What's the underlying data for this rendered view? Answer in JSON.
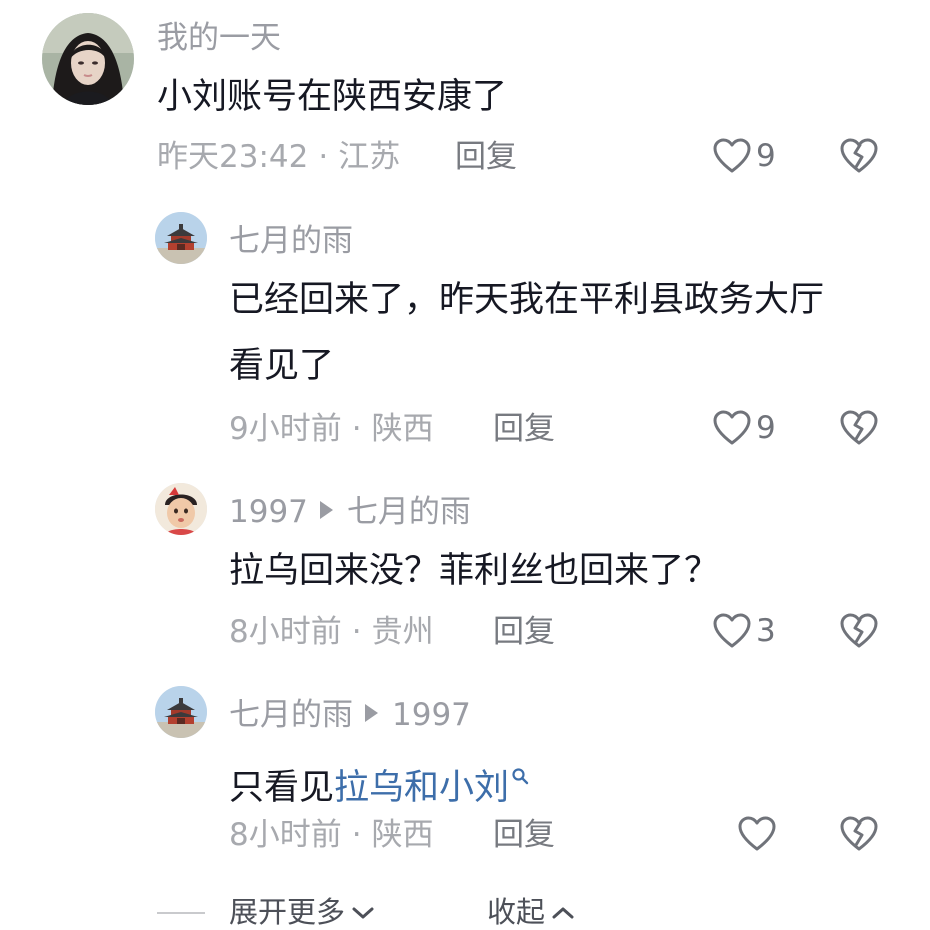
{
  "comments": [
    {
      "author": "我的一天",
      "text_lines": [
        "小刘账号在陕西安康了"
      ],
      "time": "昨天23:42",
      "location": "江苏",
      "reply_label": "回复",
      "like_count": "9",
      "avatar": "woman-portrait-avatar"
    },
    {
      "author": "七月的雨",
      "text_lines": [
        "已经回来了，昨天我在平利县政务大厅",
        "看见了"
      ],
      "time": "9小时前",
      "location": "陕西",
      "reply_label": "回复",
      "like_count": "9",
      "avatar": "pagoda-building-avatar"
    },
    {
      "author": "1997",
      "reply_to": "七月的雨",
      "text_lines": [
        "拉乌回来没？菲利丝也回来了？"
      ],
      "time": "8小时前",
      "location": "贵州",
      "reply_label": "回复",
      "like_count": "3",
      "avatar": "baby-photo-avatar"
    },
    {
      "author": "七月的雨",
      "reply_to": "1997",
      "text_prefix": "只看见",
      "text_keyword": "拉乌和小刘",
      "time": "8小时前",
      "location": "陕西",
      "reply_label": "回复",
      "like_count": "",
      "avatar": "pagoda-building-avatar"
    }
  ],
  "separator": "·",
  "footer": {
    "expand_label": "展开更多",
    "collapse_label": "收起"
  },
  "colors": {
    "text": "#161823",
    "secondary": "#a7a9ae",
    "keyword_link": "#3d6eaa"
  },
  "icons": [
    "heart-outline-icon",
    "broken-heart-icon",
    "search-icon",
    "chevron-down-icon",
    "chevron-up-icon"
  ]
}
